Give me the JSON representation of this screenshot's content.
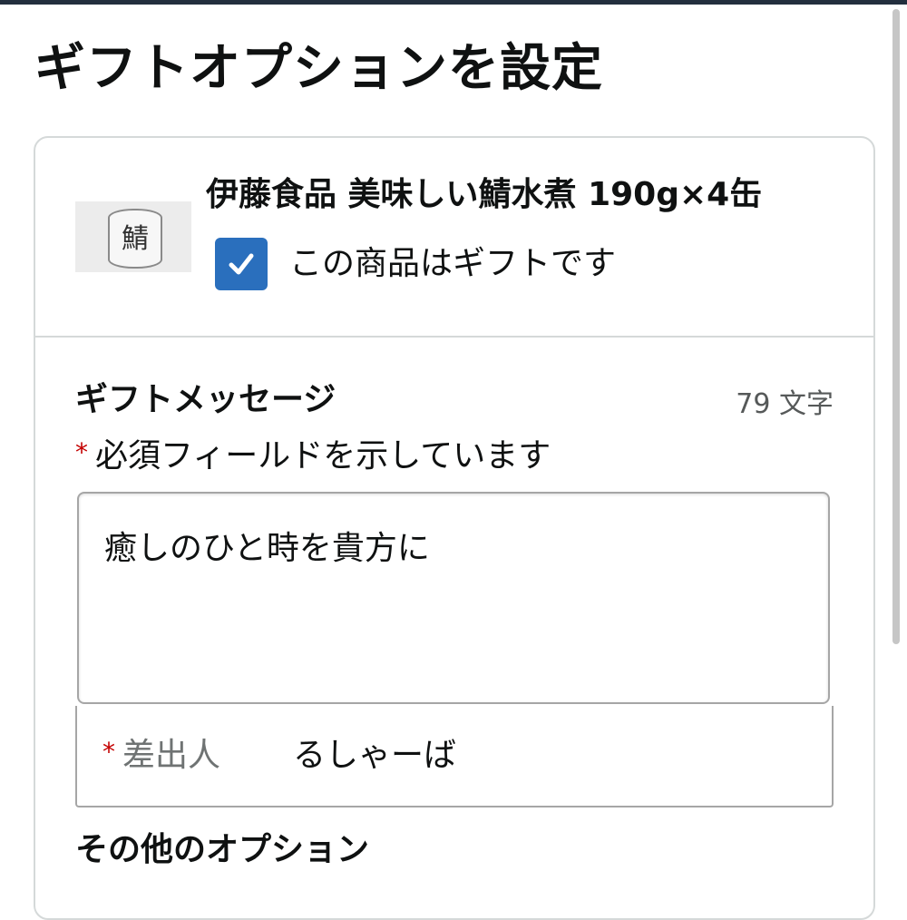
{
  "page": {
    "title": "ギフトオプションを設定"
  },
  "product": {
    "name": "伊藤食品 美味しい鯖水煮 190g×4缶",
    "image_kanji": "鯖",
    "is_gift_label": "この商品はギフトです",
    "is_gift_checked": true
  },
  "gift_message": {
    "title": "ギフトメッセージ",
    "char_count": "79 文字",
    "required_marker": "*",
    "required_note": "必須フィールドを示しています",
    "message_value": "癒しのひと時を貴方に",
    "sender_label": "差出人",
    "sender_value": "るしゃーば"
  },
  "other_options": {
    "title": "その他のオプション"
  },
  "icons": {
    "checkbox": "checkmark-icon"
  },
  "colors": {
    "checkbox_fill": "#2a6fbd",
    "required_asterisk": "#c40000",
    "top_bar": "#232f3e"
  }
}
